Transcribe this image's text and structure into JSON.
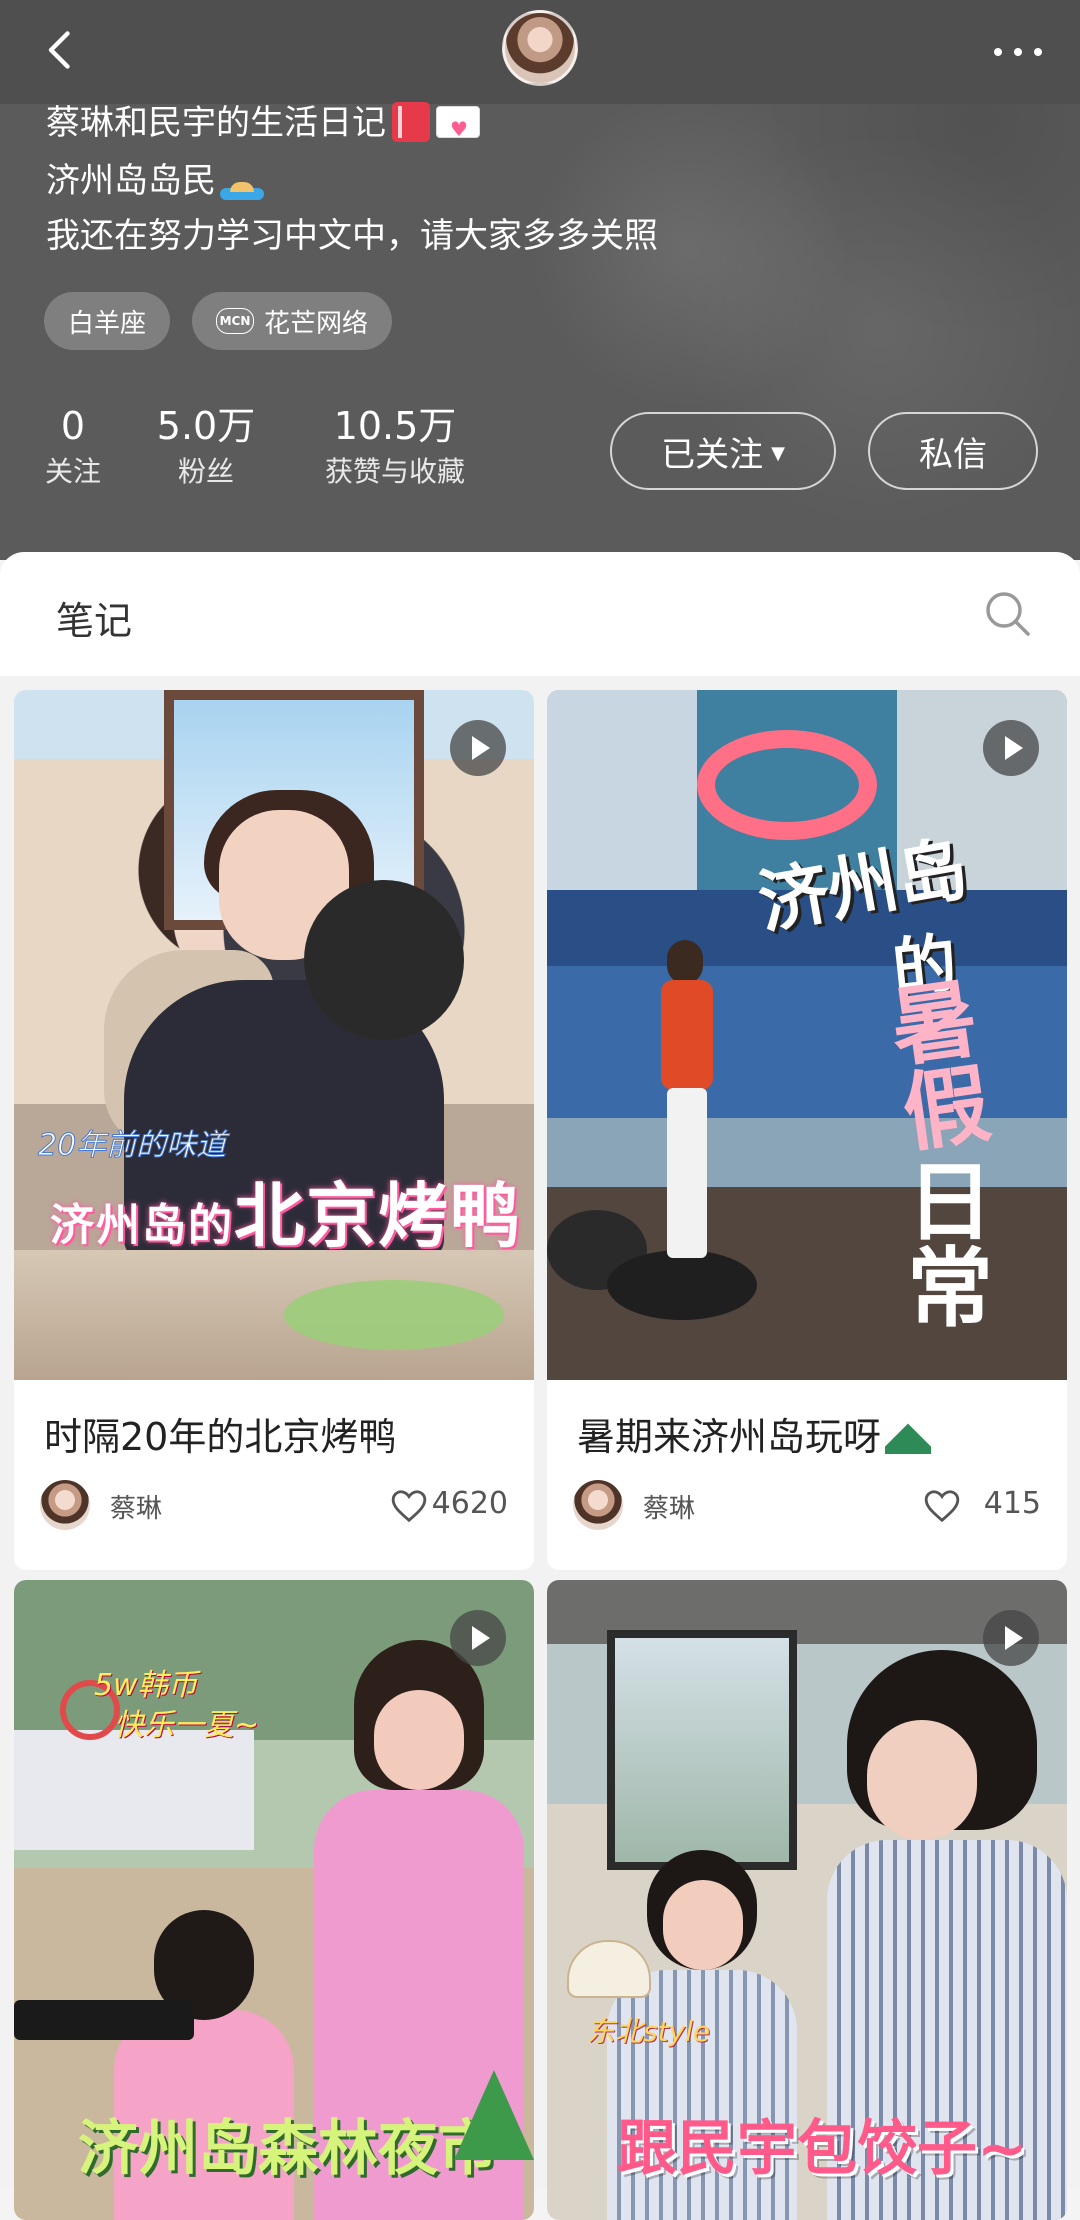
{
  "header": {
    "back_icon": "chevron-left-icon",
    "more_icon": "more-icon"
  },
  "profile": {
    "bio": [
      "蔡琳和民宇的生活日记",
      "济州岛岛民",
      "我还在努力学习中文中，请大家多多关照"
    ],
    "tags": [
      {
        "label": "白羊座"
      },
      {
        "badge": "MCN",
        "label": "花芒网络"
      }
    ],
    "stats": [
      {
        "value": "0",
        "label": "关注"
      },
      {
        "value": "5.0万",
        "label": "粉丝"
      },
      {
        "value": "10.5万",
        "label": "获赞与收藏"
      }
    ],
    "follow_label": "已关注",
    "message_label": "私信"
  },
  "notes_tab": {
    "title": "笔记",
    "search_icon": "search-icon"
  },
  "feed": [
    {
      "title": "时隔20年的北京烤鸭",
      "author": "蔡琳",
      "likes": "4620",
      "video": true,
      "cover_sub": "20年前的味道",
      "cover_text_a": "济州岛的",
      "cover_text_b": "北京烤鸭"
    },
    {
      "title": "暑期来济州岛玩呀",
      "author": "蔡琳",
      "likes": "415",
      "video": true,
      "cover_text_a": "济州岛",
      "cover_text_b": "的",
      "cover_text_c": "暑假",
      "cover_text_d": "日常"
    },
    {
      "video": true,
      "cover_sub_a": "5w韩币",
      "cover_sub_b": "快乐一夏~",
      "cover_text": "济州岛森林夜市"
    },
    {
      "video": true,
      "cover_sub": "东北style",
      "cover_text": "跟民宇包饺子~"
    }
  ],
  "colors": {
    "header_bg": "#5b5b5b",
    "accent_like": "#555555"
  }
}
